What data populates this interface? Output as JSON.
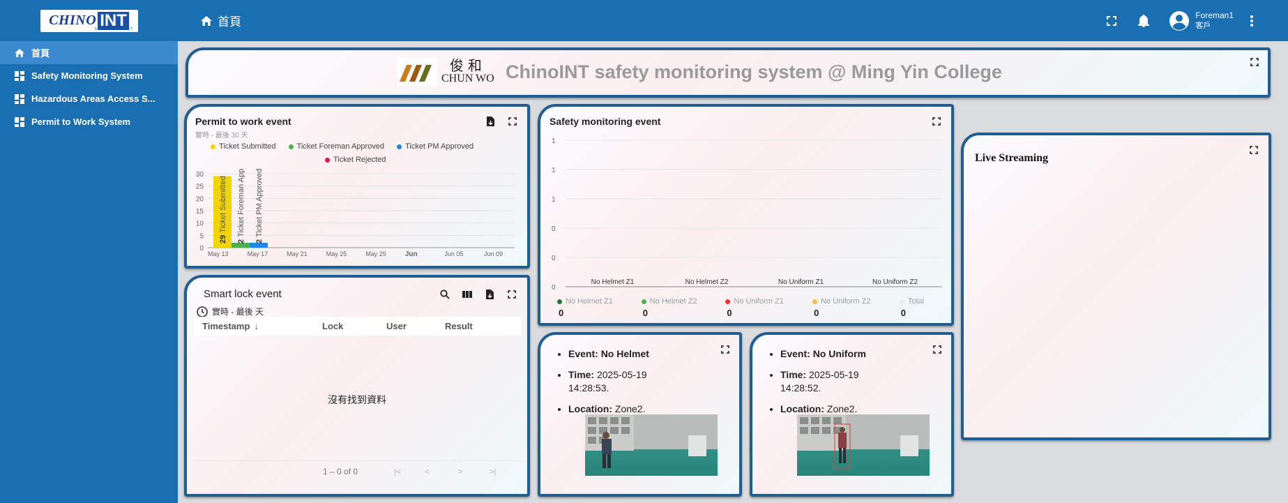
{
  "header": {
    "logo_main": "CHINO",
    "logo_int": "INT",
    "logo_tagline": "SENSE CONNECT",
    "breadcrumb": "首頁",
    "user_name": "Foreman1",
    "user_role": "客戶"
  },
  "sidebar": {
    "items": [
      {
        "label": "首頁",
        "icon": "home-icon",
        "active": true
      },
      {
        "label": "Safety Monitoring System",
        "icon": "dashboard-icon"
      },
      {
        "label": "Hazardous Areas Access S...",
        "icon": "dashboard-icon"
      },
      {
        "label": "Permit to Work System",
        "icon": "dashboard-icon"
      }
    ]
  },
  "banner": {
    "cw_logo_cn": "俊和",
    "cw_logo_en": "CHUN WO",
    "title": "ChinoINT safety monitoring system @ Ming Yin College"
  },
  "permit": {
    "title": "Permit to work event",
    "subtitle": "實時 - 最後 30 天",
    "legend": [
      {
        "label": "Ticket Submitted",
        "color": "#f2d400"
      },
      {
        "label": "Ticket Foreman Approved",
        "color": "#4caf50"
      },
      {
        "label": "Ticket PM Approved",
        "color": "#1e88e5"
      },
      {
        "label": "Ticket Rejected",
        "color": "#e0134f"
      }
    ]
  },
  "safety": {
    "title": "Safety monitoring event",
    "legend": [
      {
        "label": "No Helmet Z1",
        "color": "#1b7a2a",
        "value": "0"
      },
      {
        "label": "No Helmet Z2",
        "color": "#4caf50",
        "value": "0"
      },
      {
        "label": "No Uniform Z1",
        "color": "#e53935",
        "value": "0"
      },
      {
        "label": "No Uniform Z2",
        "color": "#fbc02d",
        "value": "0"
      },
      {
        "label": "Total",
        "color": "#eeeeee",
        "value": "0"
      }
    ]
  },
  "live": {
    "title": "Live Streaming"
  },
  "smartlock": {
    "title": "Smart lock event",
    "subtitle": "實時 - 最後 天",
    "columns": [
      "Timestamp",
      "Lock",
      "User",
      "Result"
    ],
    "empty_text": "沒有找到資料",
    "pagination": "1 – 0 of 0"
  },
  "event_cards": [
    {
      "event_label": "Event:",
      "event": "No Helmet",
      "time_label": "Time:",
      "time": "2025-05-19 14:28:53.",
      "location_label": "Location:",
      "location": "Zone2."
    },
    {
      "event_label": "Event:",
      "event": "No Uniform",
      "time_label": "Time:",
      "time": "2025-05-19 14:28:52.",
      "location_label": "Location:",
      "location": "Zone2."
    }
  ],
  "chart_data": [
    {
      "type": "bar",
      "title": "Permit to work event",
      "x_ticks": [
        "May 13",
        "May 17",
        "May 21",
        "May 25",
        "May 29",
        "Jun",
        "Jun 05",
        "Jun 09"
      ],
      "ylim": [
        0,
        30
      ],
      "y_ticks": [
        0,
        5,
        10,
        15,
        20,
        25,
        30
      ],
      "grid": true,
      "legend_position": "top",
      "series": [
        {
          "name": "Ticket Submitted",
          "color": "#f2d400",
          "x": [
            "May 15"
          ],
          "values": [
            29
          ],
          "value_label": "29",
          "bar_label": "Ticket Submitted"
        },
        {
          "name": "Ticket Foreman Approved",
          "color": "#4caf50",
          "x": [
            "May 15"
          ],
          "values": [
            2
          ],
          "value_label": "2",
          "bar_label": "Ticket Foreman Appr"
        },
        {
          "name": "Ticket PM Approved",
          "color": "#1e88e5",
          "x": [
            "May 15"
          ],
          "values": [
            2
          ],
          "value_label": "2",
          "bar_label": "Ticket PM Approved"
        },
        {
          "name": "Ticket Rejected",
          "color": "#e0134f",
          "x": [],
          "values": []
        }
      ]
    },
    {
      "type": "bar",
      "title": "Safety monitoring event",
      "categories": [
        "No Helmet Z1",
        "No Helmet Z2",
        "No Uniform Z1",
        "No Uniform Z2"
      ],
      "y_ticks": [
        "0",
        "0",
        "0",
        "1",
        "1",
        "1"
      ],
      "grid": true,
      "legend_position": "bottom",
      "series": [
        {
          "name": "No Helmet Z1",
          "values": [
            0,
            0,
            0,
            0
          ]
        },
        {
          "name": "No Helmet Z2",
          "values": [
            0,
            0,
            0,
            0
          ]
        },
        {
          "name": "No Uniform Z1",
          "values": [
            0,
            0,
            0,
            0
          ]
        },
        {
          "name": "No Uniform Z2",
          "values": [
            0,
            0,
            0,
            0
          ]
        },
        {
          "name": "Total",
          "values": [
            0,
            0,
            0,
            0
          ]
        }
      ]
    }
  ]
}
